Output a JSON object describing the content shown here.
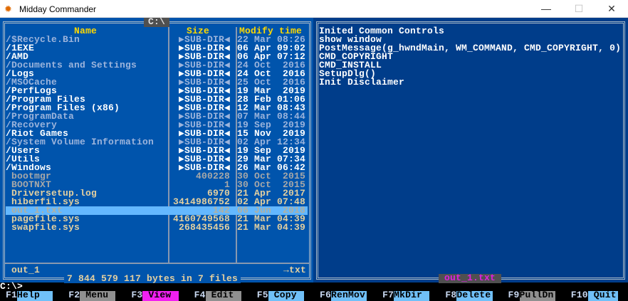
{
  "window": {
    "title": "Midday Commander",
    "minimize": "—",
    "maximize": "☐",
    "close": "✕"
  },
  "left_panel": {
    "path": "C:\\",
    "headers": {
      "name": "Name",
      "size": "Size",
      "time": "Modify time"
    },
    "rows": [
      {
        "name": "/$Recycle.Bin",
        "size": "▶SUB-DIR◀",
        "time": "22 Mar 08:26",
        "type": "hid"
      },
      {
        "name": "/1EXE",
        "size": "▶SUB-DIR◀",
        "time": "06 Apr 09:02",
        "type": "dir"
      },
      {
        "name": "/AMD",
        "size": "▶SUB-DIR◀",
        "time": "06 Apr 07:12",
        "type": "dir"
      },
      {
        "name": "/Documents and Settings",
        "size": "▶SUB-DIR◀",
        "time": "24 Oct  2016",
        "type": "hid"
      },
      {
        "name": "/Logs",
        "size": "▶SUB-DIR◀",
        "time": "24 Oct  2016",
        "type": "dir"
      },
      {
        "name": "/MSOCache",
        "size": "▶SUB-DIR◀",
        "time": "25 Oct  2016",
        "type": "hid"
      },
      {
        "name": "/PerfLogs",
        "size": "▶SUB-DIR◀",
        "time": "19 Mar  2019",
        "type": "dir"
      },
      {
        "name": "/Program Files",
        "size": "▶SUB-DIR◀",
        "time": "28 Feb 01:06",
        "type": "dir"
      },
      {
        "name": "/Program Files (x86)",
        "size": "▶SUB-DIR◀",
        "time": "12 Mar 08:43",
        "type": "dir"
      },
      {
        "name": "/ProgramData",
        "size": "▶SUB-DIR◀",
        "time": "07 Mar 08:44",
        "type": "hid"
      },
      {
        "name": "/Recovery",
        "size": "▶SUB-DIR◀",
        "time": "19 Sep  2019",
        "type": "hid"
      },
      {
        "name": "/Riot Games",
        "size": "▶SUB-DIR◀",
        "time": "15 Nov  2019",
        "type": "dir"
      },
      {
        "name": "/System Volume Information",
        "size": "▶SUB-DIR◀",
        "time": "02 Apr 12:34",
        "type": "hid"
      },
      {
        "name": "/Users",
        "size": "▶SUB-DIR◀",
        "time": "19 Sep  2019",
        "type": "dir"
      },
      {
        "name": "/Utils",
        "size": "▶SUB-DIR◀",
        "time": "29 Mar 07:34",
        "type": "dir"
      },
      {
        "name": "/Windows",
        "size": "▶SUB-DIR◀",
        "time": "26 Mar 06:42",
        "type": "dir"
      },
      {
        "name": " bootmgr",
        "size": "400228",
        "time": "30 Oct  2015",
        "type": "sys"
      },
      {
        "name": " BOOTNXT",
        "size": "1",
        "time": "30 Oct  2015",
        "type": "sys"
      },
      {
        "name": " Driversetup.log",
        "size": "6970",
        "time": "21 Apr  2017",
        "type": "file"
      },
      {
        "name": " hiberfil.sys",
        "size": "3414986752",
        "time": "02 Apr 07:48",
        "type": "file"
      },
      {
        "name": " out_1.txt",
        "size": "142",
        "time": "06 Jun  2018",
        "type": "file",
        "selected": true
      },
      {
        "name": " pagefile.sys",
        "size": "4160749568",
        "time": "21 Mar 04:39",
        "type": "file"
      },
      {
        "name": " swapfile.sys",
        "size": "268435456",
        "time": "21 Mar 04:39",
        "type": "file"
      }
    ],
    "current_file": "out_1",
    "current_ext": "→txt",
    "summary": "7 844 579 117 bytes in 7 files"
  },
  "right_panel": {
    "lines": [
      "Inited Common Controls",
      "show window",
      "PostMessage(g_hwndMain, WM_COMMAND, CMD_COPYRIGHT, 0)",
      "CMD_COPYRIGHT",
      "CMD_INSTALL",
      "SetupDlg()",
      "Init Disclaimer"
    ],
    "filename": "out_1.txt"
  },
  "command_line": "C:\\>",
  "fkeys": [
    {
      "key": "F1",
      "label": "Help",
      "style": ""
    },
    {
      "key": "F2",
      "label": " Menu",
      "style": "grey"
    },
    {
      "key": "F3",
      "label": " View",
      "style": "mag"
    },
    {
      "key": "F4",
      "label": " Edit",
      "style": "grey"
    },
    {
      "key": "F5",
      "label": " Copy",
      "style": ""
    },
    {
      "key": "F6",
      "label": "RenMov",
      "style": ""
    },
    {
      "key": "F7",
      "label": "MkDir",
      "style": ""
    },
    {
      "key": "F8",
      "label": "Delete",
      "style": ""
    },
    {
      "key": "F9",
      "label": "PullDn",
      "style": "grey"
    },
    {
      "key": "F10",
      "label": " Quit",
      "style": ""
    }
  ]
}
